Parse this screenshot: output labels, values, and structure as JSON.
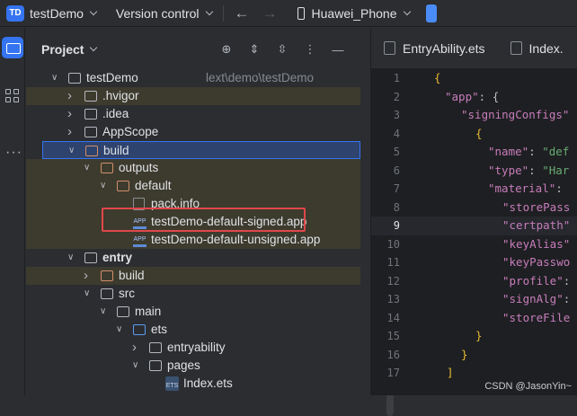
{
  "topbar": {
    "project_badge": "TD",
    "project_name": "testDemo",
    "version_control": "Version control",
    "device": "Huawei_Phone"
  },
  "panel": {
    "title": "Project"
  },
  "tree": [
    {
      "label": "testDemo",
      "path": "lext\\demo\\testDemo",
      "depth": 0,
      "open": true,
      "icon": "folder-icon"
    },
    {
      "label": ".hvigor",
      "depth": 1,
      "open": false,
      "icon": "folder-icon",
      "olive": true
    },
    {
      "label": ".idea",
      "depth": 1,
      "open": false,
      "icon": "folder-icon"
    },
    {
      "label": "AppScope",
      "depth": 1,
      "open": false,
      "icon": "folder-icon"
    },
    {
      "label": "build",
      "depth": 1,
      "open": true,
      "icon": "folder-icon",
      "build": true,
      "selected": true
    },
    {
      "label": "outputs",
      "depth": 2,
      "open": true,
      "icon": "folder-icon",
      "build": true,
      "olive": true
    },
    {
      "label": "default",
      "depth": 3,
      "open": true,
      "icon": "folder-icon",
      "build": true,
      "olive": true
    },
    {
      "label": "pack.info",
      "depth": 4,
      "icon": "file-icon",
      "olive": true
    },
    {
      "label": "testDemo-default-signed.app",
      "depth": 4,
      "icon": "app-icon",
      "olive": true
    },
    {
      "label": "testDemo-default-unsigned.app",
      "depth": 4,
      "icon": "app-icon",
      "olive": true
    },
    {
      "label": "entry",
      "depth": 1,
      "open": true,
      "icon": "folder-icon",
      "bold": true
    },
    {
      "label": "build",
      "depth": 2,
      "open": false,
      "icon": "folder-icon",
      "build": true,
      "olive": true
    },
    {
      "label": "src",
      "depth": 2,
      "open": true,
      "icon": "folder-icon"
    },
    {
      "label": "main",
      "depth": 3,
      "open": true,
      "icon": "folder-icon"
    },
    {
      "label": "ets",
      "depth": 4,
      "open": true,
      "icon": "folder-icon",
      "blue": true
    },
    {
      "label": "entryability",
      "depth": 5,
      "open": false,
      "icon": "folder-icon"
    },
    {
      "label": "pages",
      "depth": 5,
      "open": true,
      "icon": "folder-icon"
    },
    {
      "label": "Index.ets",
      "depth": 6,
      "icon": "ets-icon"
    }
  ],
  "editor": {
    "tabs": [
      "EntryAbility.ets",
      "Index."
    ],
    "lines": [
      {
        "n": "1",
        "text": "{"
      },
      {
        "n": "2",
        "key": "\"app\"",
        "rest": ": {"
      },
      {
        "n": "3",
        "key": "\"signingConfigs\"",
        "rest": ""
      },
      {
        "n": "4",
        "text": "{"
      },
      {
        "n": "5",
        "key": "\"name\"",
        "rest": ": ",
        "val": "\"def"
      },
      {
        "n": "6",
        "key": "\"type\"",
        "rest": ": ",
        "val": "\"Har"
      },
      {
        "n": "7",
        "key": "\"material\"",
        "rest": ":"
      },
      {
        "n": "8",
        "key": "\"storePass"
      },
      {
        "n": "9",
        "key": "\"certpath\"",
        "current": true
      },
      {
        "n": "10",
        "key": "\"keyAlias\""
      },
      {
        "n": "11",
        "key": "\"keyPasswo"
      },
      {
        "n": "12",
        "key": "\"profile\"",
        "rest": ":"
      },
      {
        "n": "13",
        "key": "\"signAlg\"",
        "rest": ":"
      },
      {
        "n": "14",
        "key": "\"storeFile"
      },
      {
        "n": "15",
        "text": "}"
      },
      {
        "n": "16",
        "text": "}"
      },
      {
        "n": "17",
        "text": "]"
      }
    ],
    "watermark": "CSDN @JasonYin~"
  },
  "colors": {
    "accent": "#3574f0",
    "highlight_box": "#e0474a",
    "string": "#6aab73",
    "json_key": "#c77dbb"
  }
}
